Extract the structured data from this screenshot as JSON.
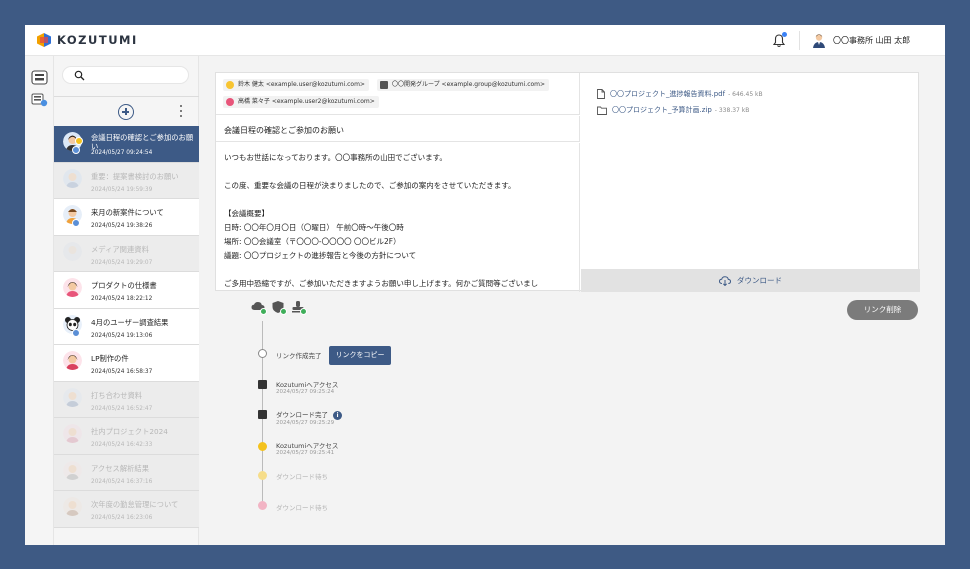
{
  "app": {
    "logo_text": "KOZUTUMI"
  },
  "header": {
    "user_name": "〇〇事務所 山田 太郎"
  },
  "sidebar": {
    "items": [
      {
        "title": "会議日程の確認とご参加のお願い",
        "date": "2024/05/27 09:24:54",
        "state": "active"
      },
      {
        "title": "重要：提案書検討のお願い",
        "date": "2024/05/24 19:59:39",
        "state": "dim"
      },
      {
        "title": "来月の新案件について",
        "date": "2024/05/24 19:38:26",
        "state": "normal"
      },
      {
        "title": "メディア関連資料",
        "date": "2024/05/24 19:29:07",
        "state": "dim"
      },
      {
        "title": "プロダクトの仕様書",
        "date": "2024/05/24 18:22:12",
        "state": "normal"
      },
      {
        "title": "4月のユーザー調査結果",
        "date": "2024/05/24 19:13:06",
        "state": "normal"
      },
      {
        "title": "LP制作の件",
        "date": "2024/05/24 16:58:37",
        "state": "normal"
      },
      {
        "title": "打ち合わせ資料",
        "date": "2024/05/24 16:52:47",
        "state": "dim"
      },
      {
        "title": "社内プロジェクト2024",
        "date": "2024/05/24 16:42:33",
        "state": "dim"
      },
      {
        "title": "アクセス解析結果",
        "date": "2024/05/24 16:37:16",
        "state": "dim"
      },
      {
        "title": "次年度の勤怠管理について",
        "date": "2024/05/24 16:23:06",
        "state": "dim"
      }
    ]
  },
  "mail": {
    "recipients": [
      {
        "label": "鈴木 健太 <example.user@kozutumi.com>"
      },
      {
        "label": "〇〇開発グループ <example.group@kozutumi.com>"
      },
      {
        "label": "高橋 菜々子 <example.user2@kozutumi.com>"
      }
    ],
    "subject": "会議日程の確認とご参加のお願い",
    "body": [
      "いつもお世話になっております。〇〇事務所の山田でございます。",
      "",
      "この度、重要な会議の日程が決まりましたので、ご参加の案内をさせていただきます。",
      "",
      "【会議概要】",
      "日時: 〇〇年〇月〇日（〇曜日） 午前〇時〜午後〇時",
      "場所: 〇〇会議室（〒〇〇〇-〇〇〇〇 〇〇ビル2F）",
      "議題: 〇〇プロジェクトの進捗報告と今後の方針について",
      "",
      "ご多用中恐縮ですが、ご参加いただきますようお願い申し上げます。何かご質問等ございまし"
    ]
  },
  "files": [
    {
      "name": "〇〇プロジェクト_進捗報告資料.pdf",
      "size": "- 646.45 kB",
      "icon": "file-icon"
    },
    {
      "name": "〇〇プロジェクト_予算計画.zip",
      "size": "- 338.37 kB",
      "icon": "folder-icon"
    }
  ],
  "download_label": "ダウンロード",
  "delete_link_label": "リンク削除",
  "timeline": {
    "link_created": "リンク作成完了",
    "copy_label": "リンクをコピー",
    "events": [
      {
        "text": "Kozutumiへアクセス",
        "time": "2024/05/27 09:25:24"
      },
      {
        "text": "ダウンロード完了",
        "time": "2024/05/27 09:25:29",
        "info": "i"
      },
      {
        "text": "Kozutumiへアクセス",
        "time": "2024/05/27 09:25:41"
      },
      {
        "text": "ダウンロード待ち",
        "time": ""
      },
      {
        "text": "ダウンロード待ち",
        "time": ""
      }
    ]
  }
}
